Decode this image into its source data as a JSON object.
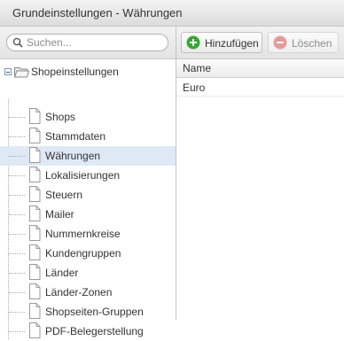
{
  "window": {
    "title": "Grundeinstellungen - Währungen"
  },
  "search": {
    "placeholder": "Suchen..."
  },
  "tree": {
    "root_label": "Shopeinstellungen",
    "items": [
      {
        "label": "Shops"
      },
      {
        "label": "Stammdaten"
      },
      {
        "label": "Währungen"
      },
      {
        "label": "Lokalisierungen"
      },
      {
        "label": "Steuern"
      },
      {
        "label": "Mailer"
      },
      {
        "label": "Nummernkreise"
      },
      {
        "label": "Kundengruppen"
      },
      {
        "label": "Länder"
      },
      {
        "label": "Länder-Zonen"
      },
      {
        "label": "Shopseiten-Gruppen"
      },
      {
        "label": "PDF-Belegerstellung"
      }
    ],
    "selected": "Währungen"
  },
  "toolbar": {
    "add_label": "Hinzufügen",
    "delete_label": "Löschen"
  },
  "grid": {
    "columns": [
      "Name"
    ],
    "rows": [
      [
        "Euro"
      ]
    ]
  },
  "colors": {
    "selected_row": "#dfe9f5",
    "add_icon": "#3aa534",
    "delete_icon": "#e39a9a"
  }
}
